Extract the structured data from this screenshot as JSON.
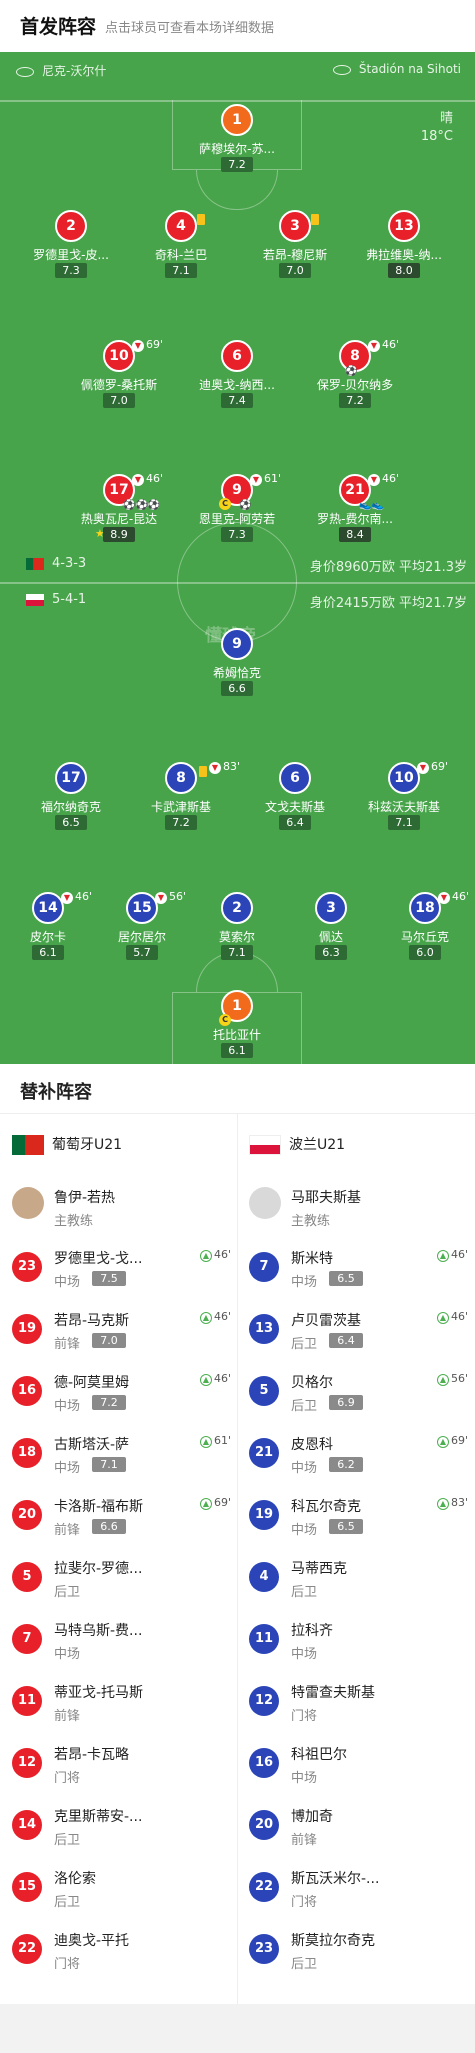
{
  "header": {
    "title": "首发阵容",
    "subtitle": "点击球员可查看本场详细数据"
  },
  "venue": {
    "team_left": "尼克-沃尔什",
    "team_right": "Štadión na Sihoti"
  },
  "weather": {
    "condition": "晴",
    "temp": "18°C"
  },
  "portugal": {
    "formation": "4-3-3",
    "value": "身价8960万欧 平均21.3岁",
    "gk": {
      "num": "1",
      "name": "萨穆埃尔-苏...",
      "rating": "7.2"
    },
    "def": [
      {
        "num": "2",
        "name": "罗德里戈-皮...",
        "rating": "7.3"
      },
      {
        "num": "4",
        "name": "奇科-兰巴",
        "rating": "7.1"
      },
      {
        "num": "3",
        "name": "若昂-穆尼斯",
        "rating": "7.0"
      },
      {
        "num": "13",
        "name": "弗拉维奥-纳...",
        "rating": "8.0"
      }
    ],
    "mid": [
      {
        "num": "10",
        "name": "佩德罗-桑托斯",
        "rating": "7.0",
        "sub": "69'"
      },
      {
        "num": "6",
        "name": "迪奥戈-纳西...",
        "rating": "7.4"
      },
      {
        "num": "8",
        "name": "保罗-贝尔纳多",
        "rating": "7.2",
        "sub": "46'"
      }
    ],
    "fwd": [
      {
        "num": "17",
        "name": "热奥瓦尼-昆达",
        "rating": "8.9",
        "sub": "46'"
      },
      {
        "num": "9",
        "name": "恩里克-阿劳若",
        "rating": "7.3",
        "sub": "61'"
      },
      {
        "num": "21",
        "name": "罗热-费尔南...",
        "rating": "8.4",
        "sub": "46'"
      }
    ]
  },
  "poland": {
    "formation": "5-4-1",
    "value": "身价2415万欧 平均21.7岁",
    "fwd": [
      {
        "num": "9",
        "name": "希姆恰克",
        "rating": "6.6"
      }
    ],
    "mid": [
      {
        "num": "17",
        "name": "福尔纳奇克",
        "rating": "6.5"
      },
      {
        "num": "8",
        "name": "卡武津斯基",
        "rating": "7.2",
        "sub": "83'"
      },
      {
        "num": "6",
        "name": "文戈夫斯基",
        "rating": "6.4"
      },
      {
        "num": "10",
        "name": "科兹沃夫斯基",
        "rating": "7.1",
        "sub": "69'"
      }
    ],
    "def": [
      {
        "num": "14",
        "name": "皮尔卡",
        "rating": "6.1",
        "sub": "46'"
      },
      {
        "num": "15",
        "name": "居尔居尔",
        "rating": "5.7",
        "sub": "56'"
      },
      {
        "num": "2",
        "name": "莫索尔",
        "rating": "7.1"
      },
      {
        "num": "3",
        "name": "佩达",
        "rating": "6.3"
      },
      {
        "num": "18",
        "name": "马尔丘克",
        "rating": "6.0",
        "sub": "46'"
      }
    ],
    "gk": {
      "num": "1",
      "name": "托比亚什",
      "rating": "6.1"
    }
  },
  "field_logo": "懂球帝",
  "subs": {
    "title": "替补阵容",
    "left_team": "葡萄牙U21",
    "right_team": "波兰U21",
    "left_coach": {
      "name": "鲁伊-若热",
      "role": "主教练"
    },
    "right_coach": {
      "name": "马耶夫斯基",
      "role": "主教练"
    },
    "left": [
      {
        "num": "23",
        "name": "罗德里戈-戈...",
        "pos": "中场",
        "rating": "7.5",
        "sub": "46'"
      },
      {
        "num": "19",
        "name": "若昂-马克斯",
        "pos": "前锋",
        "rating": "7.0",
        "sub": "46'"
      },
      {
        "num": "16",
        "name": "德-阿莫里姆",
        "pos": "中场",
        "rating": "7.2",
        "sub": "46'"
      },
      {
        "num": "18",
        "name": "古斯塔沃-萨",
        "pos": "中场",
        "rating": "7.1",
        "sub": "61'"
      },
      {
        "num": "20",
        "name": "卡洛斯-福布斯",
        "pos": "前锋",
        "rating": "6.6",
        "sub": "69'"
      },
      {
        "num": "5",
        "name": "拉斐尔-罗德...",
        "pos": "后卫"
      },
      {
        "num": "7",
        "name": "马特乌斯-费...",
        "pos": "中场"
      },
      {
        "num": "11",
        "name": "蒂亚戈-托马斯",
        "pos": "前锋"
      },
      {
        "num": "12",
        "name": "若昂-卡瓦略",
        "pos": "门将"
      },
      {
        "num": "14",
        "name": "克里斯蒂安-...",
        "pos": "后卫"
      },
      {
        "num": "15",
        "name": "洛伦索",
        "pos": "后卫"
      },
      {
        "num": "22",
        "name": "迪奥戈-平托",
        "pos": "门将"
      }
    ],
    "right": [
      {
        "num": "7",
        "name": "斯米特",
        "pos": "中场",
        "rating": "6.5",
        "sub": "46'"
      },
      {
        "num": "13",
        "name": "卢贝雷茨基",
        "pos": "后卫",
        "rating": "6.4",
        "sub": "46'"
      },
      {
        "num": "5",
        "name": "贝格尔",
        "pos": "后卫",
        "rating": "6.9",
        "sub": "56'"
      },
      {
        "num": "21",
        "name": "皮恩科",
        "pos": "中场",
        "rating": "6.2",
        "sub": "69'"
      },
      {
        "num": "19",
        "name": "科瓦尔奇克",
        "pos": "中场",
        "rating": "6.5",
        "sub": "83'"
      },
      {
        "num": "4",
        "name": "马蒂西克",
        "pos": "后卫"
      },
      {
        "num": "11",
        "name": "拉科齐",
        "pos": "中场"
      },
      {
        "num": "12",
        "name": "特雷查夫斯基",
        "pos": "门将"
      },
      {
        "num": "16",
        "name": "科祖巴尔",
        "pos": "中场"
      },
      {
        "num": "20",
        "name": "博加奇",
        "pos": "前锋"
      },
      {
        "num": "22",
        "name": "斯瓦沃米尔-...",
        "pos": "门将"
      },
      {
        "num": "23",
        "name": "斯莫拉尔奇克",
        "pos": "后卫"
      }
    ]
  }
}
